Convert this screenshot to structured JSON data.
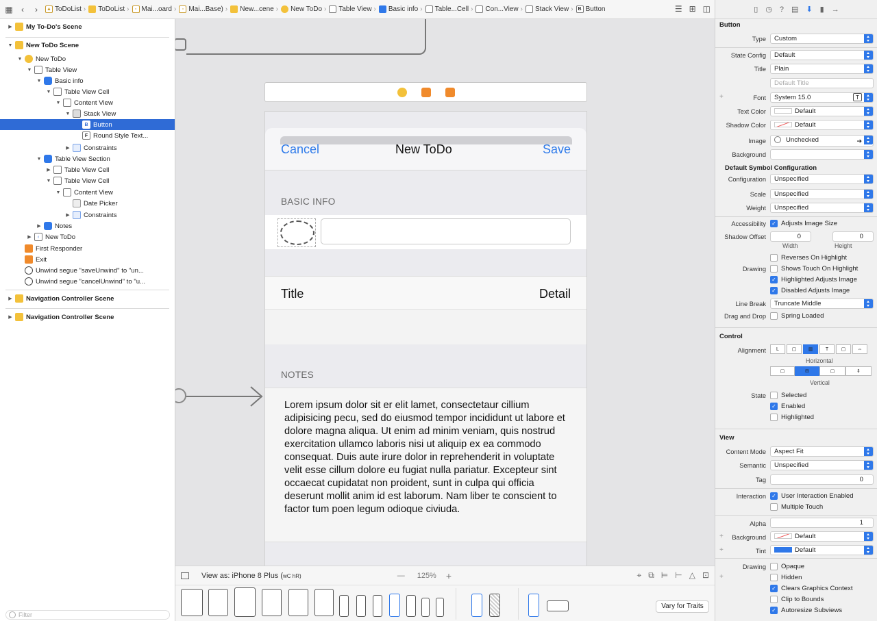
{
  "jumpbar": {
    "crumbs": [
      "ToDoList",
      "ToDoList",
      "Mai...oard",
      "Mai...Base)",
      "New...cene",
      "New ToDo",
      "Table View",
      "Basic info",
      "Table...Cell",
      "Con...View",
      "Stack View",
      "Button"
    ]
  },
  "outline": {
    "my_todos_scene": "My To-Do's Scene",
    "new_todo_scene": "New ToDo Scene",
    "new_todo": "New ToDo",
    "table_view": "Table View",
    "basic_info": "Basic info",
    "table_view_cell": "Table View Cell",
    "content_view": "Content View",
    "stack_view": "Stack View",
    "button": "Button",
    "round_style": "Round Style Text...",
    "constraints": "Constraints",
    "table_view_section": "Table View Section",
    "table_view_cell_2": "Table View Cell",
    "table_view_cell_3": "Table View Cell",
    "content_view_2": "Content View",
    "date_picker": "Date Picker",
    "constraints_2": "Constraints",
    "notes": "Notes",
    "new_todo_nav": "New ToDo",
    "first_responder": "First Responder",
    "exit": "Exit",
    "unwind_save": "Unwind segue \"saveUnwind\" to \"un...",
    "unwind_cancel": "Unwind segue \"cancelUnwind\" to \"u...",
    "nav_scene_1": "Navigation Controller Scene",
    "nav_scene_2": "Navigation Controller Scene",
    "filter_placeholder": "Filter"
  },
  "phone": {
    "cancel": "Cancel",
    "title": "New ToDo",
    "save": "Save",
    "basic_info_header": "BASIC INFO",
    "cell_title": "Title",
    "cell_detail": "Detail",
    "notes_header": "NOTES",
    "notes_text": "Lorem ipsum dolor sit er elit lamet, consectetaur cillium adipisicing pecu, sed do eiusmod tempor incididunt ut labore et dolore magna aliqua. Ut enim ad minim veniam, quis nostrud exercitation ullamco laboris nisi ut aliquip ex ea commodo consequat. Duis aute irure dolor in reprehenderit in voluptate velit esse cillum dolore eu fugiat nulla pariatur. Excepteur sint occaecat cupidatat non proident, sunt in culpa qui officia deserunt mollit anim id est laborum. Nam liber te conscient to factor tum poen legum odioque civiuda."
  },
  "bottombar": {
    "view_as": "View as: iPhone 8 Plus (",
    "traits": "wC hR)",
    "zoom_minus": "—",
    "zoom": "125%",
    "zoom_plus": "+",
    "vary_for_traits": "Vary for Traits"
  },
  "inspector": {
    "button_header": "Button",
    "type_label": "Type",
    "type_value": "Custom",
    "state_config_label": "State Config",
    "state_config_value": "Default",
    "title_label": "Title",
    "title_value": "Plain",
    "title_placeholder": "Default Title",
    "font_label": "Font",
    "font_value": "System 15.0",
    "text_color_label": "Text Color",
    "text_color_value": "Default",
    "shadow_color_label": "Shadow Color",
    "shadow_color_value": "Default",
    "image_label": "Image",
    "image_value": "Unchecked",
    "background_label": "Background",
    "background_value": "",
    "symbol_header": "Default Symbol Configuration",
    "configuration_label": "Configuration",
    "configuration_value": "Unspecified",
    "scale_label": "Scale",
    "scale_value": "Unspecified",
    "weight_label": "Weight",
    "weight_value": "Unspecified",
    "accessibility_label": "Accessibility",
    "adjusts_image_size": "Adjusts Image Size",
    "shadow_offset_label": "Shadow Offset",
    "shadow_w": "0",
    "shadow_h": "0",
    "width_label": "Width",
    "height_label": "Height",
    "reverses_on_highlight": "Reverses On Highlight",
    "drawing_label": "Drawing",
    "shows_touch": "Shows Touch On Highlight",
    "highlighted_adjusts": "Highlighted Adjusts Image",
    "disabled_adjusts": "Disabled Adjusts Image",
    "line_break_label": "Line Break",
    "line_break_value": "Truncate Middle",
    "drag_drop_label": "Drag and Drop",
    "spring_loaded": "Spring Loaded",
    "control_header": "Control",
    "alignment_label": "Alignment",
    "horizontal_label": "Horizontal",
    "vertical_label": "Vertical",
    "state_label": "State",
    "selected": "Selected",
    "enabled": "Enabled",
    "highlighted": "Highlighted",
    "view_header": "View",
    "content_mode_label": "Content Mode",
    "content_mode_value": "Aspect Fit",
    "semantic_label": "Semantic",
    "semantic_value": "Unspecified",
    "tag_label": "Tag",
    "tag_value": "0",
    "interaction_label": "Interaction",
    "user_interaction": "User Interaction Enabled",
    "multiple_touch": "Multiple Touch",
    "alpha_label": "Alpha",
    "alpha_value": "1",
    "background2_label": "Background",
    "background2_value": "Default",
    "tint_label": "Tint",
    "tint_value": "Default",
    "drawing2_label": "Drawing",
    "opaque": "Opaque",
    "hidden": "Hidden",
    "clears_graphics": "Clears Graphics Context",
    "clip_to_bounds": "Clip to Bounds",
    "autoresize": "Autoresize Subviews"
  },
  "colors": {
    "accent": "#2f78e9",
    "scene_yellow": "#f3c13a",
    "ios_blue": "#2f7bea"
  }
}
